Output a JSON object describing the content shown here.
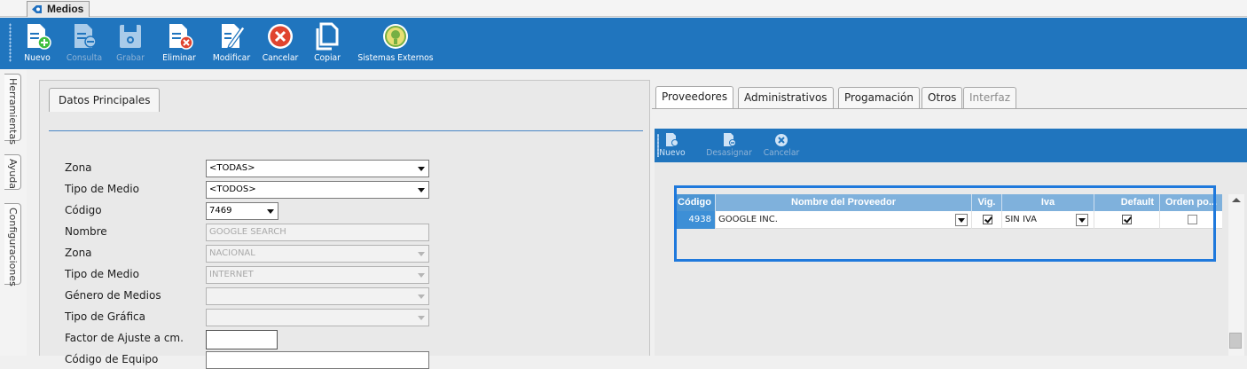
{
  "document_tab": {
    "label": "Medios"
  },
  "toolbar": {
    "buttons": [
      {
        "label": "Nuevo",
        "icon": "new-document-icon",
        "enabled": true
      },
      {
        "label": "Consulta",
        "icon": "query-document-icon",
        "enabled": false
      },
      {
        "label": "Grabar",
        "icon": "save-disk-icon",
        "enabled": false
      },
      {
        "label": "Eliminar",
        "icon": "delete-document-icon",
        "enabled": true
      },
      {
        "label": "Modificar",
        "icon": "edit-document-icon",
        "enabled": true
      },
      {
        "label": "Cancelar",
        "icon": "cancel-circle-icon",
        "enabled": true
      },
      {
        "label": "Copiar",
        "icon": "copy-icon",
        "enabled": true
      },
      {
        "label": "Sistemas Externos",
        "icon": "external-systems-icon",
        "enabled": true
      }
    ]
  },
  "side_tabs": [
    {
      "label": "Herramientas"
    },
    {
      "label": "Ayuda"
    },
    {
      "label": "Configuraciones"
    }
  ],
  "left_panel": {
    "tab_label": "Datos Principales",
    "fields": [
      {
        "label": "Zona",
        "value": "<TODAS>",
        "type": "select",
        "readonly": false
      },
      {
        "label": "Tipo de Medio",
        "value": "<TODOS>",
        "type": "select",
        "readonly": false
      },
      {
        "label": "Código",
        "value": "7469",
        "type": "select",
        "readonly": false
      },
      {
        "label": "Nombre",
        "value": "GOOGLE SEARCH",
        "type": "text",
        "readonly": true
      },
      {
        "label": "Zona",
        "value": "NACIONAL",
        "type": "select",
        "readonly": true
      },
      {
        "label": "Tipo de Medio",
        "value": "INTERNET",
        "type": "select",
        "readonly": true
      },
      {
        "label": "Género de Medios",
        "value": "",
        "type": "select",
        "readonly": true
      },
      {
        "label": "Tipo de Gráfica",
        "value": "",
        "type": "select",
        "readonly": true
      },
      {
        "label": "Factor de Ajuste a cm.",
        "value": "",
        "type": "text",
        "readonly": false
      },
      {
        "label": "Código de Equipo",
        "value": "",
        "type": "text",
        "readonly": false
      }
    ]
  },
  "right_panel": {
    "tabs": [
      {
        "label": "Proveedores",
        "active": true,
        "enabled": true
      },
      {
        "label": "Administrativos",
        "active": false,
        "enabled": true
      },
      {
        "label": "Progamación",
        "active": false,
        "enabled": true
      },
      {
        "label": "Otros",
        "active": false,
        "enabled": true
      },
      {
        "label": "Interfaz",
        "active": false,
        "enabled": false
      }
    ],
    "sub_toolbar": [
      {
        "label": "Nuevo",
        "icon": "new-document-icon"
      },
      {
        "label": "Desasignar",
        "icon": "unassign-document-icon"
      },
      {
        "label": "Cancelar",
        "icon": "cancel-circle-icon"
      }
    ],
    "grid": {
      "columns": [
        "Código",
        "Nombre del Proveedor",
        "Vig.",
        "Iva",
        "Default",
        "Orden po..."
      ],
      "rows": [
        {
          "codigo": "4938",
          "nombre": "GOOGLE INC.",
          "vig": true,
          "iva": "SIN IVA",
          "default": true,
          "orden": false
        }
      ]
    }
  },
  "colors": {
    "toolbar_blue": "#2075be",
    "grid_header": "#7fb1dc",
    "highlight": "#1f79dc"
  }
}
